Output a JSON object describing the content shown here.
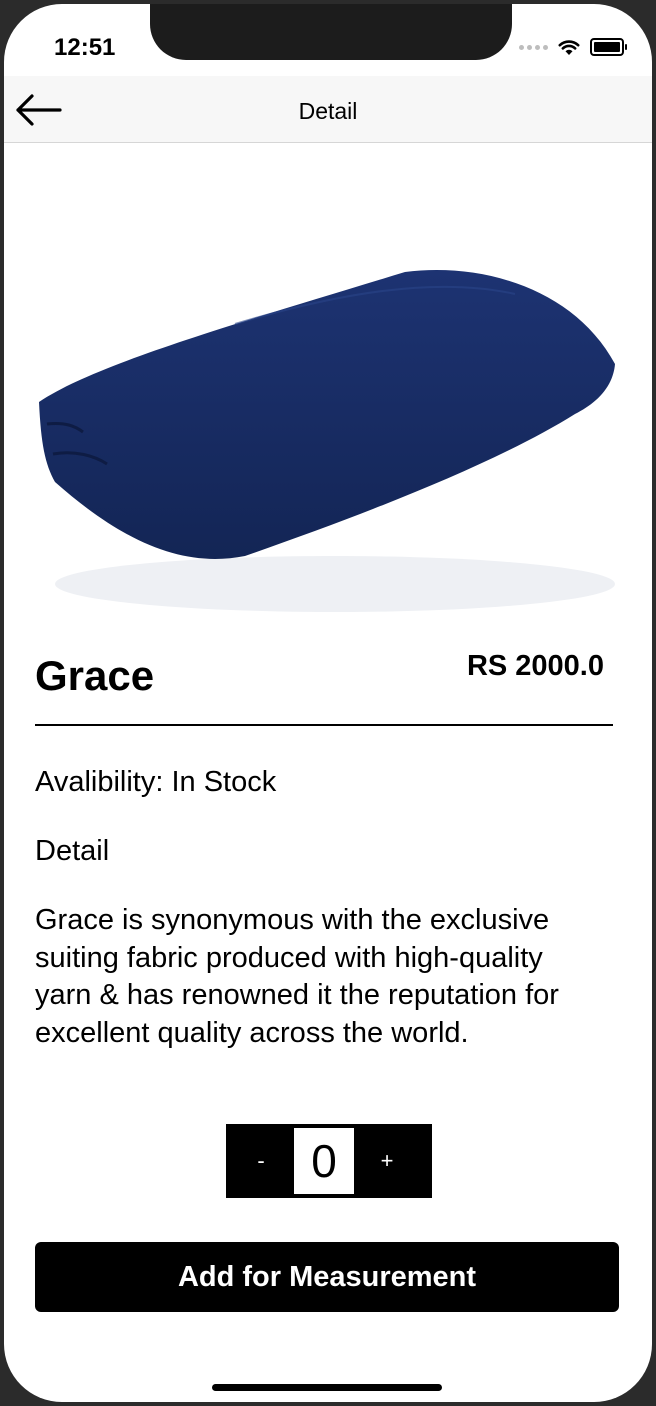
{
  "status_bar": {
    "time": "12:51"
  },
  "navbar": {
    "title": "Detail"
  },
  "product": {
    "name": "Grace",
    "price": "RS 2000.0",
    "availability": "Avalibility: In Stock",
    "detail_heading": "Detail",
    "description": "Grace is synonymous with the exclusive suiting fabric produced with high-quality yarn & has renowned it the reputation for excellent quality across the world.",
    "fabric_color": "#1c2f66"
  },
  "stepper": {
    "minus_label": "-",
    "value": "0",
    "plus_label": "+"
  },
  "actions": {
    "add_label": "Add for Measurement"
  }
}
